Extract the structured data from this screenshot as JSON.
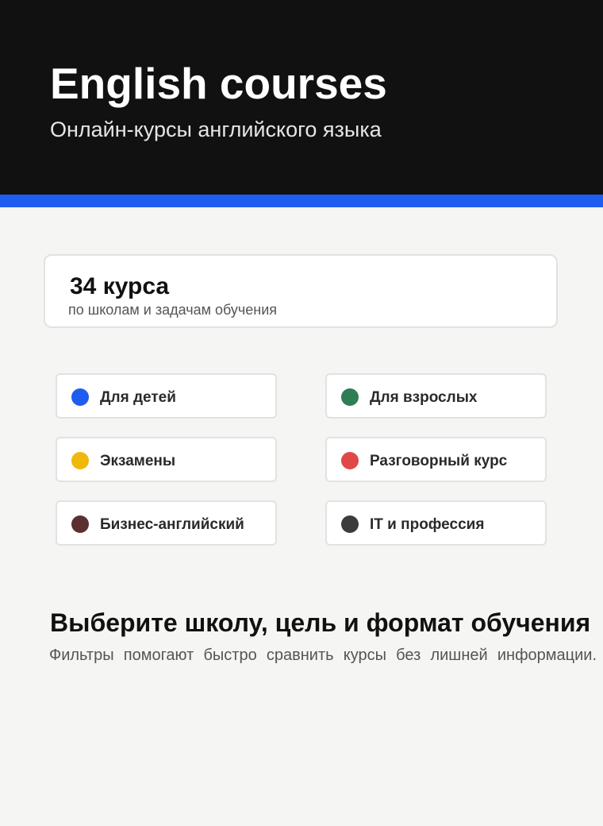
{
  "hero": {
    "title": "English courses",
    "subtitle": "Онлайн-курсы английского языка"
  },
  "accent_color": "#1f5cf0",
  "stats": {
    "count": "34 курса",
    "caption": "по школам и задачам обучения"
  },
  "filters": [
    {
      "label": "Для детей",
      "color": "#1f5cf0"
    },
    {
      "label": "Для взрослых",
      "color": "#2e7d55"
    },
    {
      "label": "Экзамены",
      "color": "#f0b80c"
    },
    {
      "label": "Разговорный курс",
      "color": "#e04848"
    },
    {
      "label": "Бизнес-английский",
      "color": "#5b3030"
    },
    {
      "label": "IT и профессия",
      "color": "#3c3c3c"
    }
  ],
  "info": {
    "headline": "Выберите школу, цель и формат обучения",
    "lead": "Фильтры помогают быстро сравнить курсы без лишней информации."
  }
}
